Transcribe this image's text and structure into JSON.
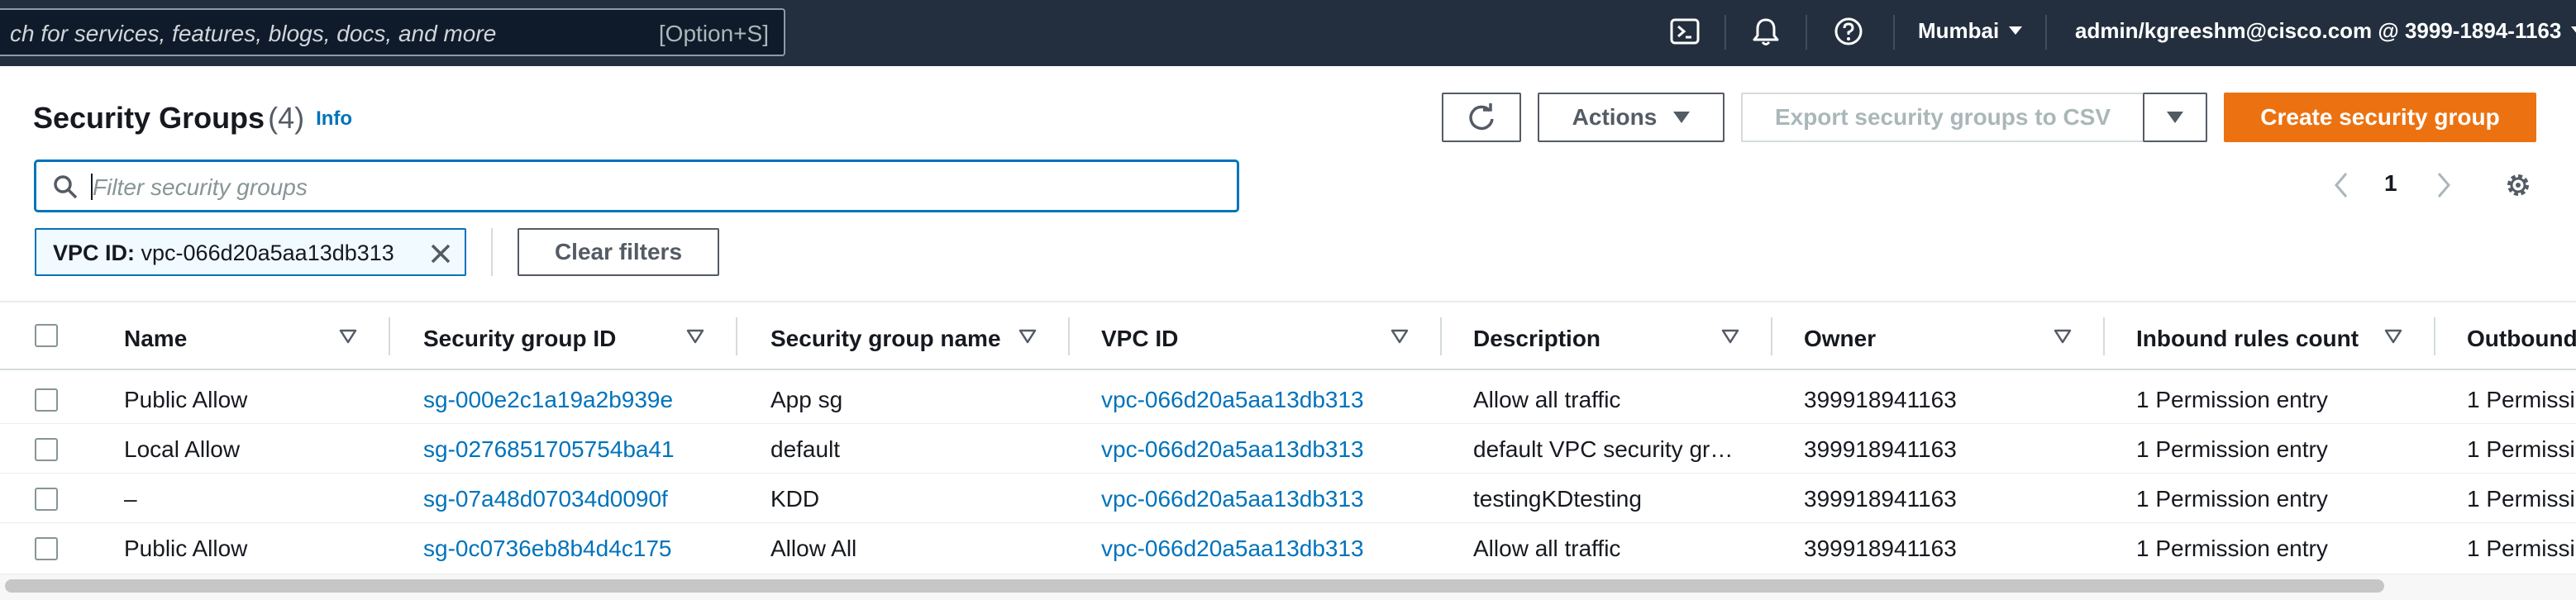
{
  "topnav": {
    "search_placeholder": "ch for services, features, blogs, docs, and more",
    "search_shortcut": "[Option+S]",
    "icons": [
      "cloudshell-icon",
      "bell-icon",
      "help-icon"
    ],
    "region": "Mumbai",
    "account": "admin/kgreeshm@cisco.com @ 3999-1894-1163"
  },
  "header": {
    "title": "Security Groups",
    "count": "(4)",
    "info": "Info"
  },
  "toolbar": {
    "actions_label": "Actions",
    "export_label": "Export security groups to CSV",
    "create_label": "Create security group"
  },
  "filter": {
    "placeholder": "Filter security groups",
    "token_key": "VPC ID:",
    "token_value": "vpc-066d20a5aa13db313",
    "clear_label": "Clear filters"
  },
  "pagination": {
    "page": "1"
  },
  "table": {
    "columns": [
      "Name",
      "Security group ID",
      "Security group name",
      "VPC ID",
      "Description",
      "Owner",
      "Inbound rules count",
      "Outbound"
    ],
    "rows": [
      {
        "name": "Public Allow",
        "sg_id": "sg-000e2c1a19a2b939e",
        "sg_name": "App sg",
        "vpc_id": "vpc-066d20a5aa13db313",
        "description": "Allow all traffic",
        "owner": "399918941163",
        "inbound": "1 Permission entry",
        "outbound": "1 Permissi"
      },
      {
        "name": "Local Allow",
        "sg_id": "sg-0276851705754ba41",
        "sg_name": "default",
        "vpc_id": "vpc-066d20a5aa13db313",
        "description": "default VPC security gr…",
        "owner": "399918941163",
        "inbound": "1 Permission entry",
        "outbound": "1 Permissi"
      },
      {
        "name": "–",
        "sg_id": "sg-07a48d07034d0090f",
        "sg_name": "KDD",
        "vpc_id": "vpc-066d20a5aa13db313",
        "description": "testingKDtesting",
        "owner": "399918941163",
        "inbound": "1 Permission entry",
        "outbound": "1 Permissi"
      },
      {
        "name": "Public Allow",
        "sg_id": "sg-0c0736eb8b4d4c175",
        "sg_name": "Allow All",
        "vpc_id": "vpc-066d20a5aa13db313",
        "description": "Allow all traffic",
        "owner": "399918941163",
        "inbound": "1 Permission entry",
        "outbound": "1 Permissi"
      }
    ]
  },
  "colors": {
    "nav_bg": "#232f3e",
    "link": "#0073bb",
    "primary": "#ec7211"
  }
}
